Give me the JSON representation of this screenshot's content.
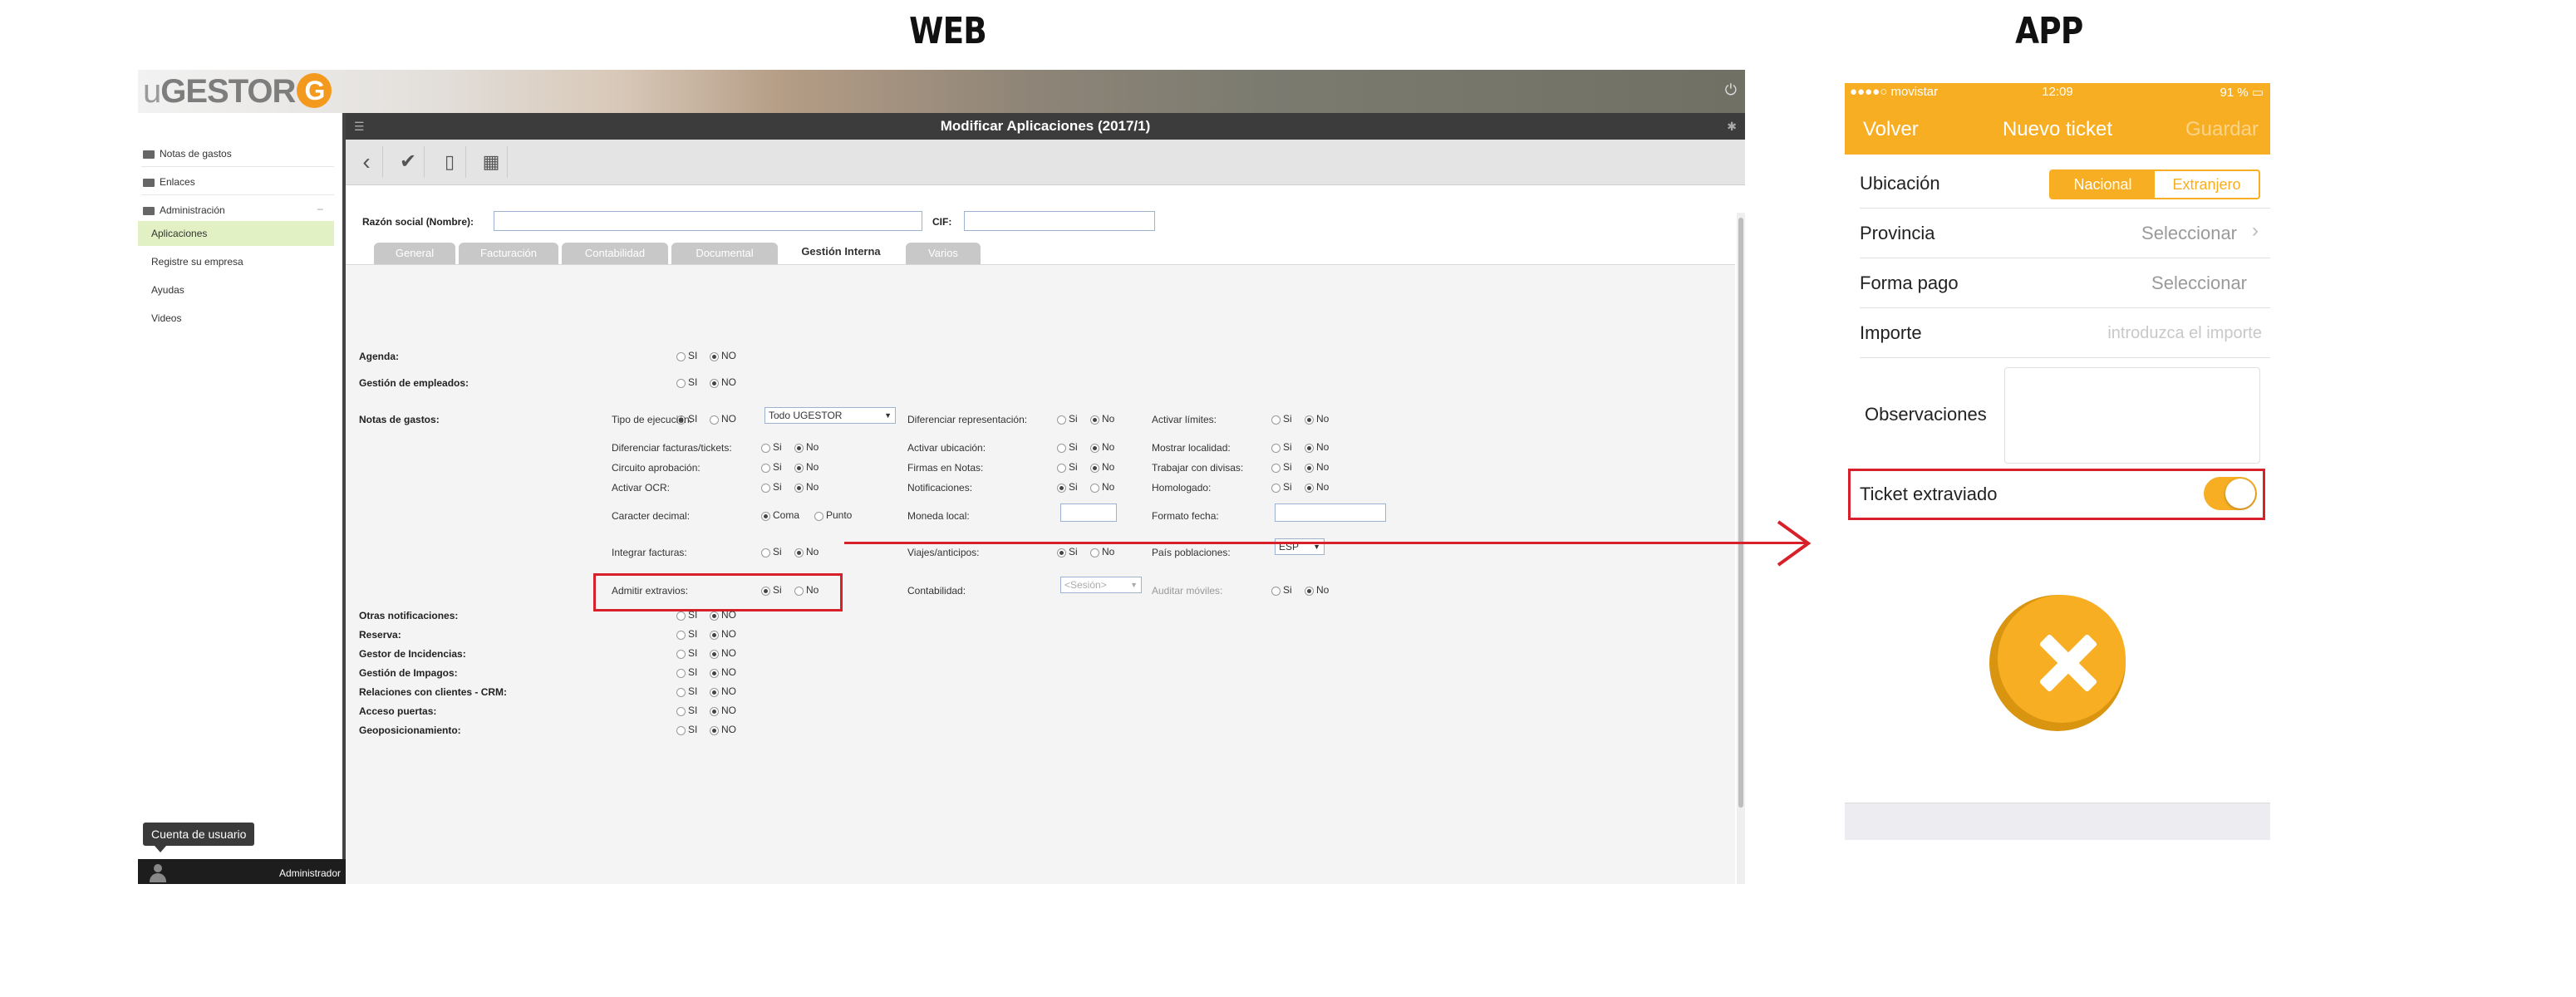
{
  "headings": {
    "web": "WEB",
    "app": "APP"
  },
  "web": {
    "logo": {
      "u": "u",
      "rest": "GESTOR",
      "g": "G"
    },
    "sidebar": {
      "items": [
        "Notas de gastos",
        "Enlaces",
        "Administración"
      ],
      "subitems": [
        "Aplicaciones",
        "Registre su empresa",
        "Ayudas",
        "Videos"
      ],
      "tooltip": "Cuenta de usuario",
      "user": "Administrador"
    },
    "window_title": "Modificar Aplicaciones (2017/1)",
    "form": {
      "razon_label": "Razón social (Nombre):",
      "cif_label": "CIF:",
      "tabs": [
        "General",
        "Facturación",
        "Contabilidad",
        "Documental",
        "Gestión Interna",
        "Varios"
      ],
      "active_tab": "Gestión Interna"
    },
    "options": {
      "si": "SI",
      "no": "NO",
      "si_l": "Si",
      "no_l": "No"
    },
    "rows": {
      "agenda": "Agenda:",
      "empleados": "Gestión de empleados:",
      "notas": "Notas de gastos:",
      "otras": "Otras notificaciones:",
      "reserva": "Reserva:",
      "incidencias": "Gestor de Incidencias:",
      "impagos": "Gestión de Impagos:",
      "crm": "Relaciones con clientes - CRM:",
      "puertas": "Acceso puertas:",
      "geo": "Geoposicionamiento:"
    },
    "notas": {
      "tipo_ejecucion": "Tipo de ejecución:",
      "tipo_value": "Todo UGESTOR",
      "dif_facturas": "Diferenciar facturas/tickets:",
      "circuito": "Circuito aprobación:",
      "ocr": "Activar OCR:",
      "caracter": "Caracter decimal:",
      "coma": "Coma",
      "punto": "Punto",
      "integrar": "Integrar facturas:",
      "admitir": "Admitir extravios:",
      "dif_repr": "Diferenciar representación:",
      "ubicacion": "Activar ubicación:",
      "firmas": "Firmas en Notas:",
      "notificaciones": "Notificaciones:",
      "moneda": "Moneda local:",
      "viajes": "Viajes/anticipos:",
      "contabilidad": "Contabilidad:",
      "contab_value": "<Sesión>",
      "limites": "Activar límites:",
      "localidad": "Mostrar localidad:",
      "divisas": "Trabajar con divisas:",
      "homologado": "Homologado:",
      "formato_fecha": "Formato fecha:",
      "pais": "País poblaciones:",
      "pais_value": "ESP",
      "auditar": "Auditar móviles:"
    }
  },
  "app": {
    "status": {
      "carrier": "●●●●○ movistar",
      "time": "12:09",
      "battery": "91 %"
    },
    "nav": {
      "back": "Volver",
      "title": "Nuevo ticket",
      "save": "Guardar"
    },
    "ubicacion": {
      "label": "Ubicación",
      "on": "Nacional",
      "off": "Extranjero"
    },
    "provincia": {
      "label": "Provincia",
      "value": "Seleccionar"
    },
    "forma_pago": {
      "label": "Forma pago",
      "value": "Seleccionar"
    },
    "importe": {
      "label": "Importe",
      "placeholder": "introduzca el importe"
    },
    "observaciones": {
      "label": "Observaciones"
    },
    "ticket_extraviado": {
      "label": "Ticket extraviado",
      "checked": true
    },
    "colors": {
      "accent": "#f7ae22",
      "highlight": "#d8202a"
    }
  }
}
